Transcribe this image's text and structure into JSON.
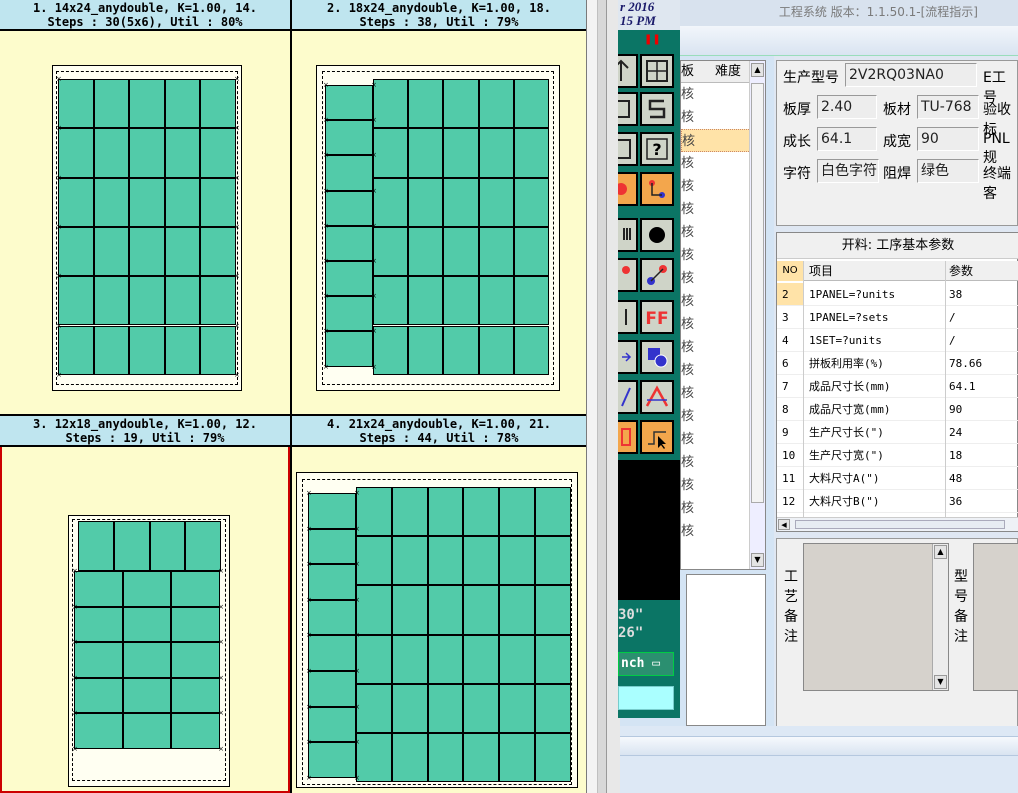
{
  "app": {
    "title": "工程系统 版本：1.1.50.1-[流程指示]",
    "clock_date": "r 2016",
    "clock_time": "15 PM",
    "pause_glyph": "❚❚"
  },
  "layouts": [
    {
      "line1": "1. 14x24_anydouble, K=1.00, 14.",
      "line2": "Steps : 30(5x6), Util : 80%"
    },
    {
      "line1": "2. 18x24_anydouble, K=1.00, 18.",
      "line2": "Steps : 38, Util : 79%"
    },
    {
      "line1": "3. 12x18_anydouble, K=1.00, 12.",
      "line2": "Steps : 19, Util : 79%"
    },
    {
      "line1": "4. 21x24_anydouble, K=1.00, 21.",
      "line2": "Steps : 44, Util : 78%"
    }
  ],
  "toolbox": {
    "dim1": "30\"",
    "dim2": "26\"",
    "unit_label": "nch ▭"
  },
  "list": {
    "col_a": "板",
    "col_b": "难度",
    "rows": [
      "核",
      "核",
      "核",
      "核",
      "核",
      "核",
      "核",
      "核",
      "核",
      "核",
      "核",
      "核",
      "核",
      "核",
      "核",
      "核",
      "核",
      "核",
      "核",
      "核"
    ]
  },
  "info": {
    "model_label": "生产型号",
    "model_value": "2V2RQ03NA0",
    "e_label": "E工号",
    "thickness_label": "板厚",
    "thickness_value": "2.40",
    "material_label": "板材",
    "material_value": "TU-768",
    "accept_label": "验收标",
    "length_label": "成长",
    "length_value": "64.1",
    "width_label": "成宽",
    "width_value": "90",
    "pnl_label": "PNL规",
    "legend_label": "字符",
    "legend_value": "白色字符",
    "mask_label": "阻焊",
    "mask_value": "绿色",
    "end_label": "终端客"
  },
  "params": {
    "title": "开料: 工序基本参数",
    "col_no": "NO",
    "col_item": "项目",
    "col_param": "参数",
    "rows": [
      {
        "no": "2",
        "item": "1PANEL=?units",
        "param": "38"
      },
      {
        "no": "3",
        "item": "1PANEL=?sets",
        "param": "/"
      },
      {
        "no": "4",
        "item": "1SET=?units",
        "param": "/"
      },
      {
        "no": "6",
        "item": "拼板利用率(%)",
        "param": "78.66"
      },
      {
        "no": "7",
        "item": "成品尺寸长(mm)",
        "param": "64.1"
      },
      {
        "no": "8",
        "item": "成品尺寸宽(mm)",
        "param": "90"
      },
      {
        "no": "9",
        "item": "生产尺寸长(\")",
        "param": "24"
      },
      {
        "no": "10",
        "item": "生产尺寸宽(\")",
        "param": "18"
      },
      {
        "no": "11",
        "item": "大料尺寸A(\")",
        "param": "48"
      },
      {
        "no": "12",
        "item": "大料尺寸B(\")",
        "param": "36"
      }
    ]
  },
  "notes": {
    "process_label": "工艺备注",
    "model_label": "型号备注",
    "process_text": "",
    "model_text": ""
  },
  "colors": {
    "unit_fill": "#52cba9",
    "panel_bg": "#fdfccc",
    "header_bg": "#bfe5ef",
    "selected_border": "#cc0000",
    "toolbox_bg": "#0b7565"
  }
}
